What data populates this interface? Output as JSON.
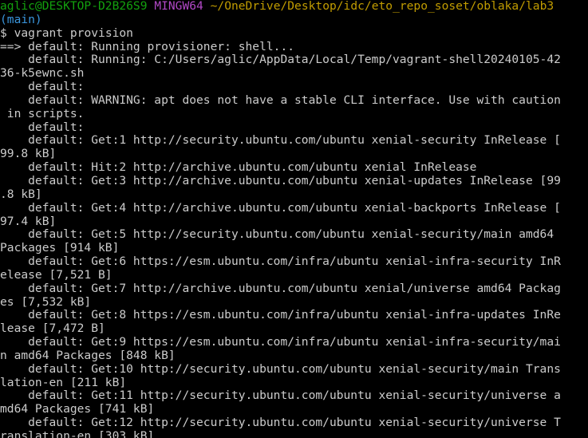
{
  "prompt": {
    "user_host": "aglic@DESKTOP-D2B26S9",
    "shell": "MINGW64",
    "path": "~/OneDrive/Desktop/idc/eto_repo_soset/oblaka/lab3",
    "branch": "(main)",
    "symbol": "$",
    "command": "vagrant provision"
  },
  "colors": {
    "user_host": "#13a10e",
    "shell": "#b148c6",
    "path": "#c19c00",
    "branch": "#3a96dd",
    "output": "#cccccc",
    "background": "#000000"
  },
  "output_lines": [
    "==> default: Running provisioner: shell...",
    "    default: Running: C:/Users/aglic/AppData/Local/Temp/vagrant-shell20240105-42",
    "36-k5ewnc.sh",
    "    default:",
    "    default: WARNING: apt does not have a stable CLI interface. Use with caution",
    " in scripts.",
    "    default:",
    "    default: Get:1 http://security.ubuntu.com/ubuntu xenial-security InRelease [",
    "99.8 kB]",
    "    default: Hit:2 http://archive.ubuntu.com/ubuntu xenial InRelease",
    "    default: Get:3 http://archive.ubuntu.com/ubuntu xenial-updates InRelease [99",
    ".8 kB]",
    "    default: Get:4 http://archive.ubuntu.com/ubuntu xenial-backports InRelease [",
    "97.4 kB]",
    "    default: Get:5 http://security.ubuntu.com/ubuntu xenial-security/main amd64",
    "Packages [914 kB]",
    "    default: Get:6 https://esm.ubuntu.com/infra/ubuntu xenial-infra-security InR",
    "elease [7,521 B]",
    "    default: Get:7 http://archive.ubuntu.com/ubuntu xenial/universe amd64 Packag",
    "es [7,532 kB]",
    "    default: Get:8 https://esm.ubuntu.com/infra/ubuntu xenial-infra-updates InRe",
    "lease [7,472 B]",
    "    default: Get:9 https://esm.ubuntu.com/infra/ubuntu xenial-infra-security/mai",
    "n amd64 Packages [848 kB]",
    "    default: Get:10 http://security.ubuntu.com/ubuntu xenial-security/main Trans",
    "lation-en [211 kB]",
    "    default: Get:11 http://security.ubuntu.com/ubuntu xenial-security/universe a",
    "md64 Packages [741 kB]",
    "    default: Get:12 http://security.ubuntu.com/ubuntu xenial-security/universe T",
    "ranslation-en [303 kB]"
  ]
}
